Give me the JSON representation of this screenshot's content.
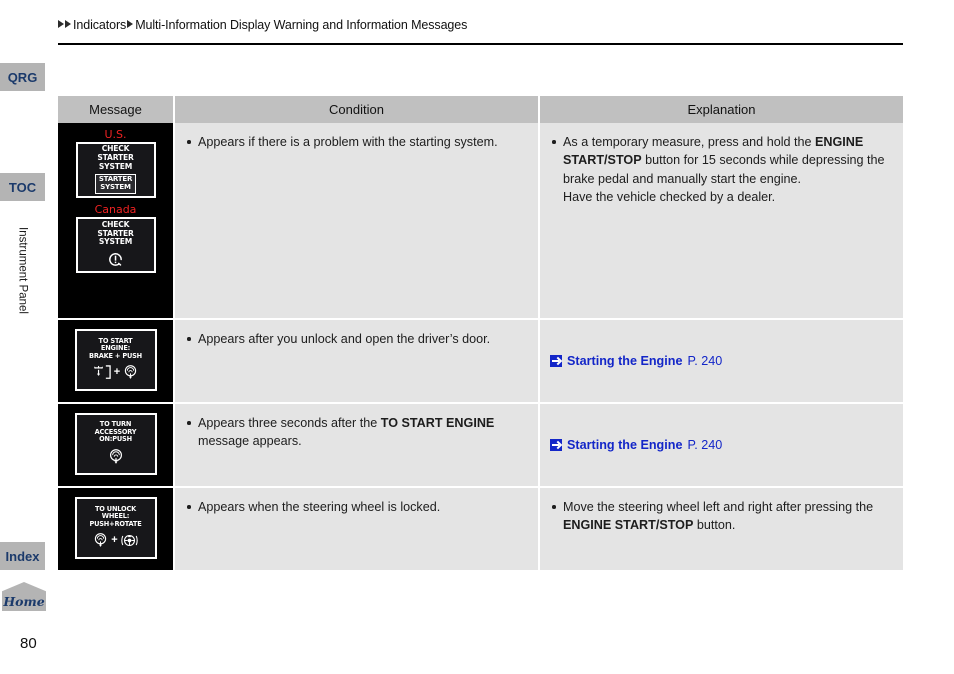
{
  "breadcrumb": {
    "item1": "Indicators",
    "item2": "Multi-Information Display Warning and Information Messages"
  },
  "sidebar": {
    "qrg": "QRG",
    "toc": "TOC",
    "section_label": "Instrument Panel",
    "index": "Index",
    "home": "Home"
  },
  "table": {
    "headers": {
      "message": "Message",
      "condition": "Condition",
      "explanation": "Explanation"
    },
    "rows": [
      {
        "message": {
          "displays": [
            {
              "region": "U.S.",
              "lines": [
                "CHECK",
                "STARTER",
                "SYSTEM"
              ],
              "badge": [
                "STARTER",
                "SYSTEM"
              ],
              "icon": "starter-system-badge-icon"
            },
            {
              "region": "Canada",
              "lines": [
                "CHECK",
                "STARTER",
                "SYSTEM"
              ],
              "icon": "exclamation-circle-icon"
            }
          ]
        },
        "condition": "Appears if there is a problem with the starting system.",
        "explanation": {
          "text_1": "As a temporary measure, press and hold the ",
          "bold_1": "ENGINE START/STOP",
          "text_2": " button for 15 seconds while depressing the brake pedal and manually start the engine.",
          "text_3": "Have the vehicle checked by a dealer."
        }
      },
      {
        "message": {
          "displays": [
            {
              "lines": [
                "TO START",
                "ENGINE:",
                "BRAKE + PUSH"
              ],
              "icons": [
                "brake-pedal-icon",
                "plus-sign",
                "push-button-icon"
              ]
            }
          ]
        },
        "condition": "Appears after you unlock and open the driver’s door.",
        "link": {
          "icon": "arrow-link-icon",
          "label": "Starting the Engine",
          "page": "P. 240"
        }
      },
      {
        "message": {
          "displays": [
            {
              "lines": [
                "TO TURN",
                "ACCESSORY",
                "ON:PUSH"
              ],
              "icons": [
                "push-button-icon"
              ]
            }
          ]
        },
        "condition_text_1": "Appears three seconds after the ",
        "condition_bold": "TO START ENGINE",
        "condition_text_2": " message appears.",
        "link": {
          "icon": "arrow-link-icon",
          "label": "Starting the Engine",
          "page": "P. 240"
        }
      },
      {
        "message": {
          "displays": [
            {
              "lines": [
                "TO UNLOCK",
                "WHEEL:",
                "PUSH+ROTATE"
              ],
              "icons": [
                "push-button-icon",
                "plus-sign",
                "steering-wheel-rotate-icon"
              ]
            }
          ]
        },
        "condition": "Appears when the steering wheel is locked.",
        "explanation": {
          "text_1": "Move the steering wheel left and right after pressing the ",
          "bold_1": "ENGINE START/STOP",
          "text_2": " button."
        }
      }
    ]
  },
  "footer": {
    "page_number": "80"
  },
  "colors": {
    "header_gray": "#c0c0c0",
    "cell_gray": "#e4e4e4",
    "tab_gray": "#b4b4b4",
    "tab_text_blue": "#1b3a6b",
    "link_blue": "#1326c8",
    "region_red": "#ee2222",
    "display_black": "#000000"
  }
}
